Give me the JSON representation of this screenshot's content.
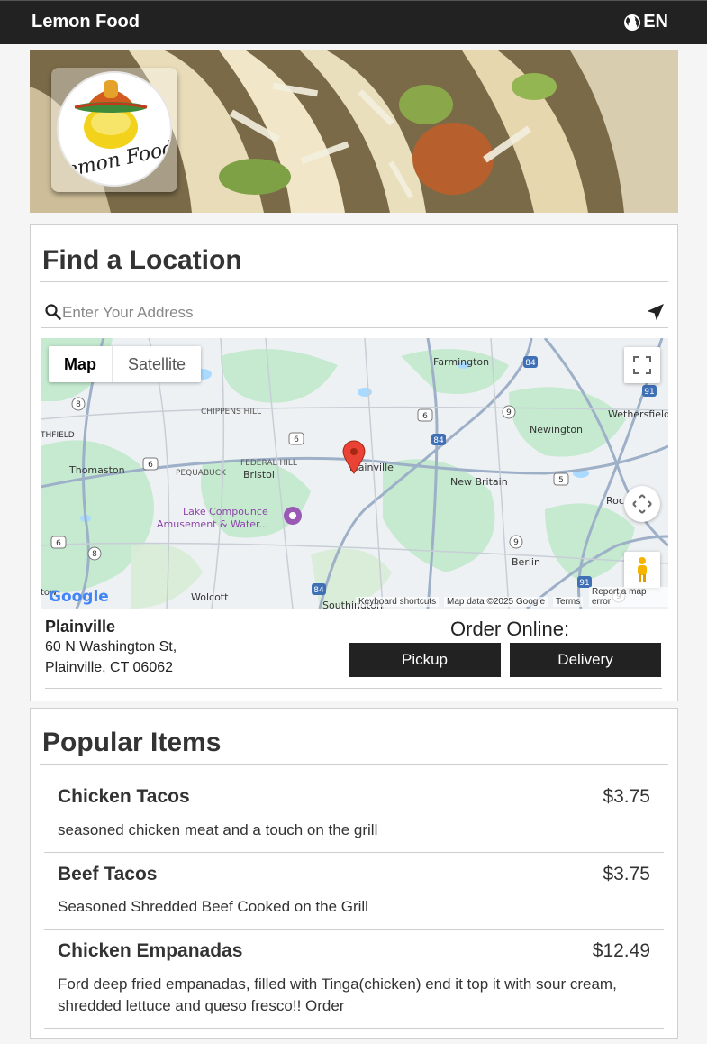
{
  "app": {
    "brand": "Lemon Food",
    "language": "EN"
  },
  "icons": {
    "globe": "globe-icon",
    "search": "search-icon",
    "send": "paper-plane-icon",
    "pin": "map-pin-icon",
    "fullscreen": "fullscreen-icon",
    "pan": "pan-arrows-icon",
    "pegman": "pegman-icon"
  },
  "hero": {
    "logo_text": "Lemon Food"
  },
  "find": {
    "title": "Find a Location",
    "search_placeholder": "Enter Your Address"
  },
  "map": {
    "type_map": "Map",
    "type_satellite": "Satellite",
    "google": "Google",
    "footer": {
      "shortcuts": "Keyboard shortcuts",
      "data": "Map data ©2025 Google",
      "terms": "Terms",
      "report": "Report a map error"
    },
    "labels": {
      "farmington": "Farmington",
      "chippens_hill": "CHIPPENS HILL",
      "thomaston": "Thomaston",
      "pequabuck": "PEQUABUCK",
      "federal_hill": "FEDERAL HILL",
      "bristol": "Bristol",
      "plainville": "Plainville",
      "new_britain": "New Britain",
      "newington": "Newington",
      "wethersfield": "Wethersfield",
      "lake1": "Lake Compounce",
      "lake2": "Amusement & Water...",
      "berlin": "Berlin",
      "wolcott": "Wolcott",
      "southington": "Southington",
      "roc": "Roc",
      "thfield": "THFIELD",
      "tow": "tow",
      "r84a": "84",
      "r84b": "84",
      "r84c": "84",
      "r6a": "6",
      "r6b": "6",
      "r6c": "6",
      "r6d": "6",
      "r8a": "8",
      "r8b": "8",
      "r9a": "9",
      "r9b": "9",
      "r9c": "9",
      "r5": "5",
      "r91a": "91",
      "r91b": "91"
    }
  },
  "location": {
    "name": "Plainville",
    "address_line1": "60 N Washington St,",
    "address_line2": "Plainville, CT 06062",
    "order_label": "Order Online:",
    "pickup": "Pickup",
    "delivery": "Delivery"
  },
  "popular": {
    "title": "Popular Items",
    "items": [
      {
        "name": "Chicken Tacos",
        "price": "$3.75",
        "desc": "seasoned chicken meat and a touch on the grill"
      },
      {
        "name": "Beef Tacos",
        "price": "$3.75",
        "desc": "Seasoned Shredded Beef Cooked on the Grill"
      },
      {
        "name": "Chicken Empanadas",
        "price": "$12.49",
        "desc": "Ford deep fried empanadas, filled with Tinga(chicken) end it top it with sour cream, shredded lettuce and queso fresco!! Order"
      }
    ]
  },
  "colors": {
    "bar": "#222222",
    "water": "#aadaff",
    "park": "#c8ecd0",
    "road": "#9db0c8",
    "pin": "#ea4335"
  }
}
